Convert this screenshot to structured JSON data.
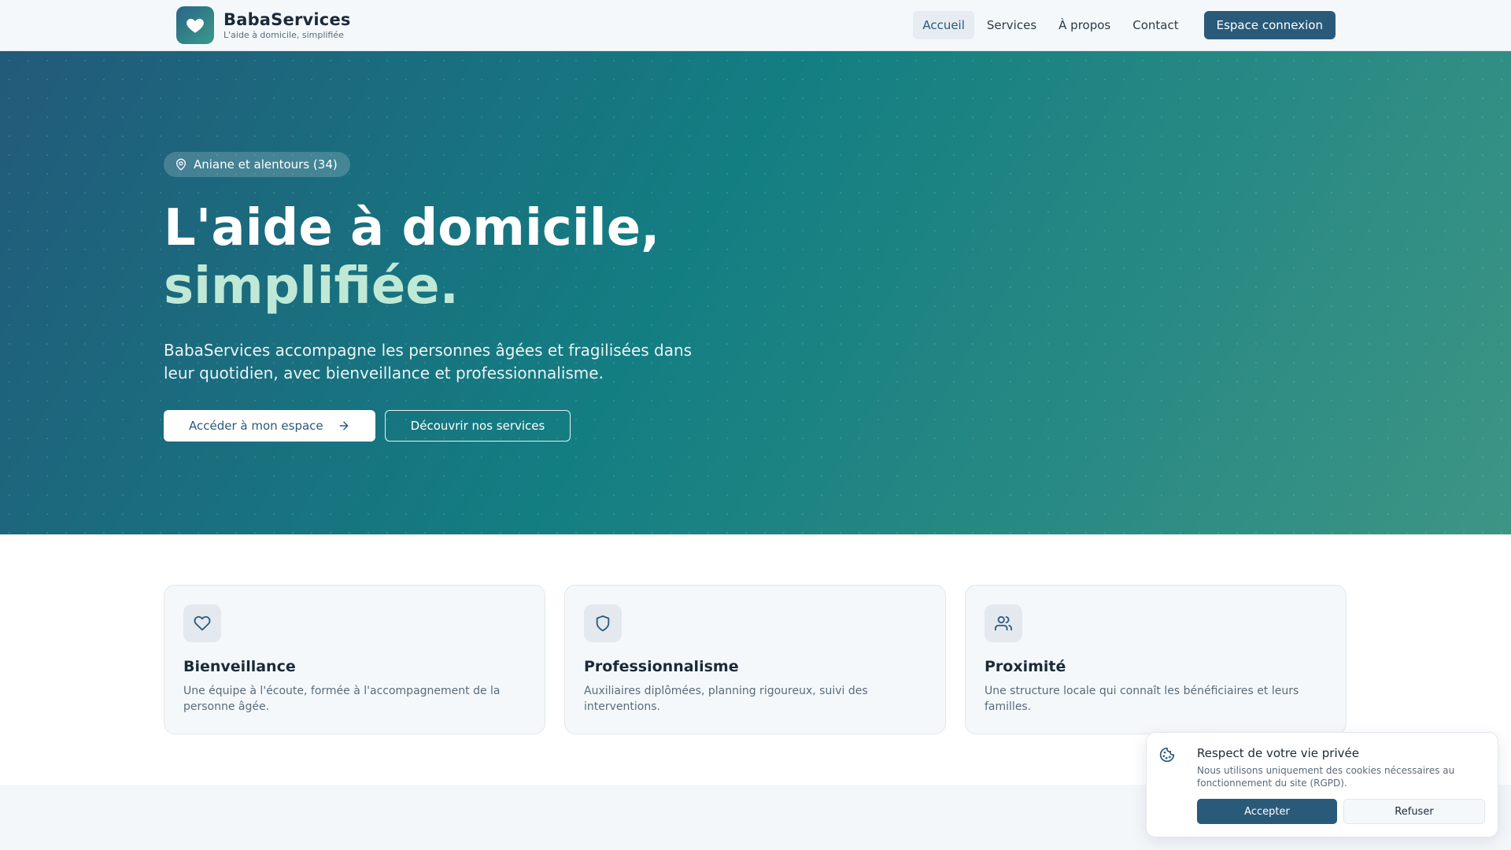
{
  "brand": {
    "name": "BabaServices",
    "tagline": "L'aide à domicile, simplifiée"
  },
  "nav": {
    "items": [
      {
        "label": "Accueil",
        "active": true
      },
      {
        "label": "Services",
        "active": false
      },
      {
        "label": "À propos",
        "active": false
      },
      {
        "label": "Contact",
        "active": false
      }
    ],
    "cta": "Espace connexion"
  },
  "hero": {
    "badge": "Aniane et alentours (34)",
    "title_line1": "L'aide à domicile,",
    "title_line2": "simplifiée.",
    "subtitle": "BabaServices accompagne les personnes âgées et fragilisées dans leur quotidien, avec bienveillance et professionnalisme.",
    "primary_button": "Accéder à mon espace",
    "secondary_button": "Découvrir nos services"
  },
  "features": [
    {
      "icon": "heart-icon",
      "title": "Bienveillance",
      "description": "Une équipe à l'écoute, formée à l'accompagnement de la personne âgée."
    },
    {
      "icon": "shield-icon",
      "title": "Professionnalisme",
      "description": "Auxiliaires diplômées, planning rigoureux, suivi des interventions."
    },
    {
      "icon": "users-icon",
      "title": "Proximité",
      "description": "Une structure locale qui connaît les bénéficiaires et leurs familles."
    }
  ],
  "cookie": {
    "icon": "cookie-icon",
    "title": "Respect de votre vie privée",
    "text": "Nous utilisons uniquement des cookies nécessaires au fonctionnement du site (RGPD).",
    "accept": "Accepter",
    "refuse": "Refuser"
  },
  "colors": {
    "primary": "#2a5a7a",
    "accent_text": "#bfe9d6",
    "hero_start": "#225a7a",
    "hero_mid": "#137e82",
    "hero_end": "#3d9585"
  }
}
